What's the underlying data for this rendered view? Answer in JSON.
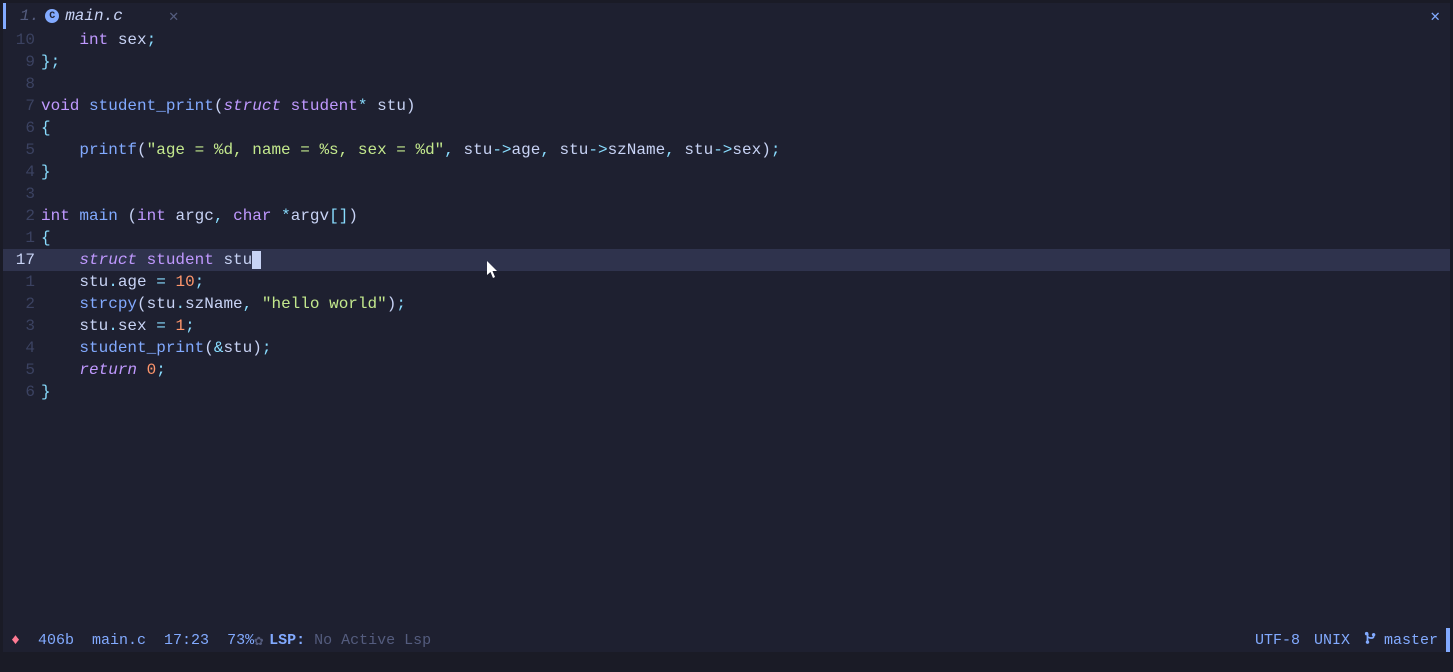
{
  "tab": {
    "index": "1.",
    "filename": "main.c",
    "icon_letter": "C"
  },
  "lines": [
    {
      "rel": "10",
      "tokens": [
        [
          "    ",
          ""
        ],
        [
          "int",
          "type"
        ],
        [
          " ",
          ""
        ],
        [
          "sex",
          "var"
        ],
        [
          ";",
          "punc"
        ]
      ]
    },
    {
      "rel": "9",
      "tokens": [
        [
          "};",
          "punc"
        ]
      ]
    },
    {
      "rel": "8",
      "tokens": []
    },
    {
      "rel": "7",
      "tokens": [
        [
          "void",
          "type"
        ],
        [
          " ",
          ""
        ],
        [
          "student_print",
          "func"
        ],
        [
          "(",
          "paren"
        ],
        [
          "struct",
          "kw"
        ],
        [
          " ",
          ""
        ],
        [
          "student",
          "type"
        ],
        [
          "*",
          "op"
        ],
        [
          " ",
          ""
        ],
        [
          "stu",
          "var"
        ],
        [
          ")",
          "paren"
        ]
      ]
    },
    {
      "rel": "6",
      "tokens": [
        [
          "{",
          "punc"
        ]
      ]
    },
    {
      "rel": "5",
      "tokens": [
        [
          "    ",
          ""
        ],
        [
          "printf",
          "func"
        ],
        [
          "(",
          "paren"
        ],
        [
          "\"age = %d, name = %s, sex = %d\"",
          "str"
        ],
        [
          ",",
          "punc"
        ],
        [
          " ",
          ""
        ],
        [
          "stu",
          "var"
        ],
        [
          "->",
          "op"
        ],
        [
          "age",
          "member"
        ],
        [
          ",",
          "punc"
        ],
        [
          " ",
          ""
        ],
        [
          "stu",
          "var"
        ],
        [
          "->",
          "op"
        ],
        [
          "szName",
          "member"
        ],
        [
          ",",
          "punc"
        ],
        [
          " ",
          ""
        ],
        [
          "stu",
          "var"
        ],
        [
          "->",
          "op"
        ],
        [
          "sex",
          "member"
        ],
        [
          ")",
          "paren"
        ],
        [
          ";",
          "punc"
        ]
      ]
    },
    {
      "rel": "4",
      "tokens": [
        [
          "}",
          "punc"
        ]
      ]
    },
    {
      "rel": "3",
      "tokens": []
    },
    {
      "rel": "2",
      "tokens": [
        [
          "int",
          "type"
        ],
        [
          " ",
          ""
        ],
        [
          "main",
          "func"
        ],
        [
          " ",
          ""
        ],
        [
          "(",
          "paren"
        ],
        [
          "int",
          "type"
        ],
        [
          " ",
          ""
        ],
        [
          "argc",
          "var"
        ],
        [
          ",",
          "punc"
        ],
        [
          " ",
          ""
        ],
        [
          "char",
          "type"
        ],
        [
          " ",
          ""
        ],
        [
          "*",
          "op"
        ],
        [
          "argv",
          "var"
        ],
        [
          "[",
          "punc"
        ],
        [
          "]",
          "punc"
        ],
        [
          ")",
          "paren"
        ]
      ]
    },
    {
      "rel": "1",
      "tokens": [
        [
          "{",
          "punc"
        ]
      ]
    },
    {
      "rel": "17",
      "current": true,
      "tokens": [
        [
          "    ",
          ""
        ],
        [
          "struct",
          "kw"
        ],
        [
          " ",
          ""
        ],
        [
          "student",
          "type"
        ],
        [
          " ",
          ""
        ],
        [
          "stu",
          "var"
        ]
      ],
      "cursor": true
    },
    {
      "rel": "1",
      "tokens": [
        [
          "    ",
          ""
        ],
        [
          "stu",
          "var"
        ],
        [
          ".",
          "op"
        ],
        [
          "age",
          "member"
        ],
        [
          " ",
          ""
        ],
        [
          "=",
          "op"
        ],
        [
          " ",
          ""
        ],
        [
          "10",
          "num"
        ],
        [
          ";",
          "punc"
        ]
      ]
    },
    {
      "rel": "2",
      "tokens": [
        [
          "    ",
          ""
        ],
        [
          "strcpy",
          "func"
        ],
        [
          "(",
          "paren"
        ],
        [
          "stu",
          "var"
        ],
        [
          ".",
          "op"
        ],
        [
          "szName",
          "member"
        ],
        [
          ",",
          "punc"
        ],
        [
          " ",
          ""
        ],
        [
          "\"hello world\"",
          "str"
        ],
        [
          ")",
          "paren"
        ],
        [
          ";",
          "punc"
        ]
      ]
    },
    {
      "rel": "3",
      "tokens": [
        [
          "    ",
          ""
        ],
        [
          "stu",
          "var"
        ],
        [
          ".",
          "op"
        ],
        [
          "sex",
          "member"
        ],
        [
          " ",
          ""
        ],
        [
          "=",
          "op"
        ],
        [
          " ",
          ""
        ],
        [
          "1",
          "num"
        ],
        [
          ";",
          "punc"
        ]
      ]
    },
    {
      "rel": "4",
      "tokens": [
        [
          "    ",
          ""
        ],
        [
          "student_print",
          "func"
        ],
        [
          "(",
          "paren"
        ],
        [
          "&",
          "op"
        ],
        [
          "stu",
          "var"
        ],
        [
          ")",
          "paren"
        ],
        [
          ";",
          "punc"
        ]
      ]
    },
    {
      "rel": "5",
      "tokens": [
        [
          "    ",
          ""
        ],
        [
          "return",
          "kw"
        ],
        [
          " ",
          ""
        ],
        [
          "0",
          "num"
        ],
        [
          ";",
          "punc"
        ]
      ]
    },
    {
      "rel": "6",
      "tokens": [
        [
          "}",
          "punc"
        ]
      ]
    }
  ],
  "status": {
    "filesize": "406b",
    "filename": "main.c",
    "position": "17:23",
    "percent": "73%",
    "lsp_prefix": "LSP:",
    "lsp_text": "No Active Lsp",
    "encoding": "UTF-8",
    "fileformat": "UNIX",
    "branch": "master"
  }
}
